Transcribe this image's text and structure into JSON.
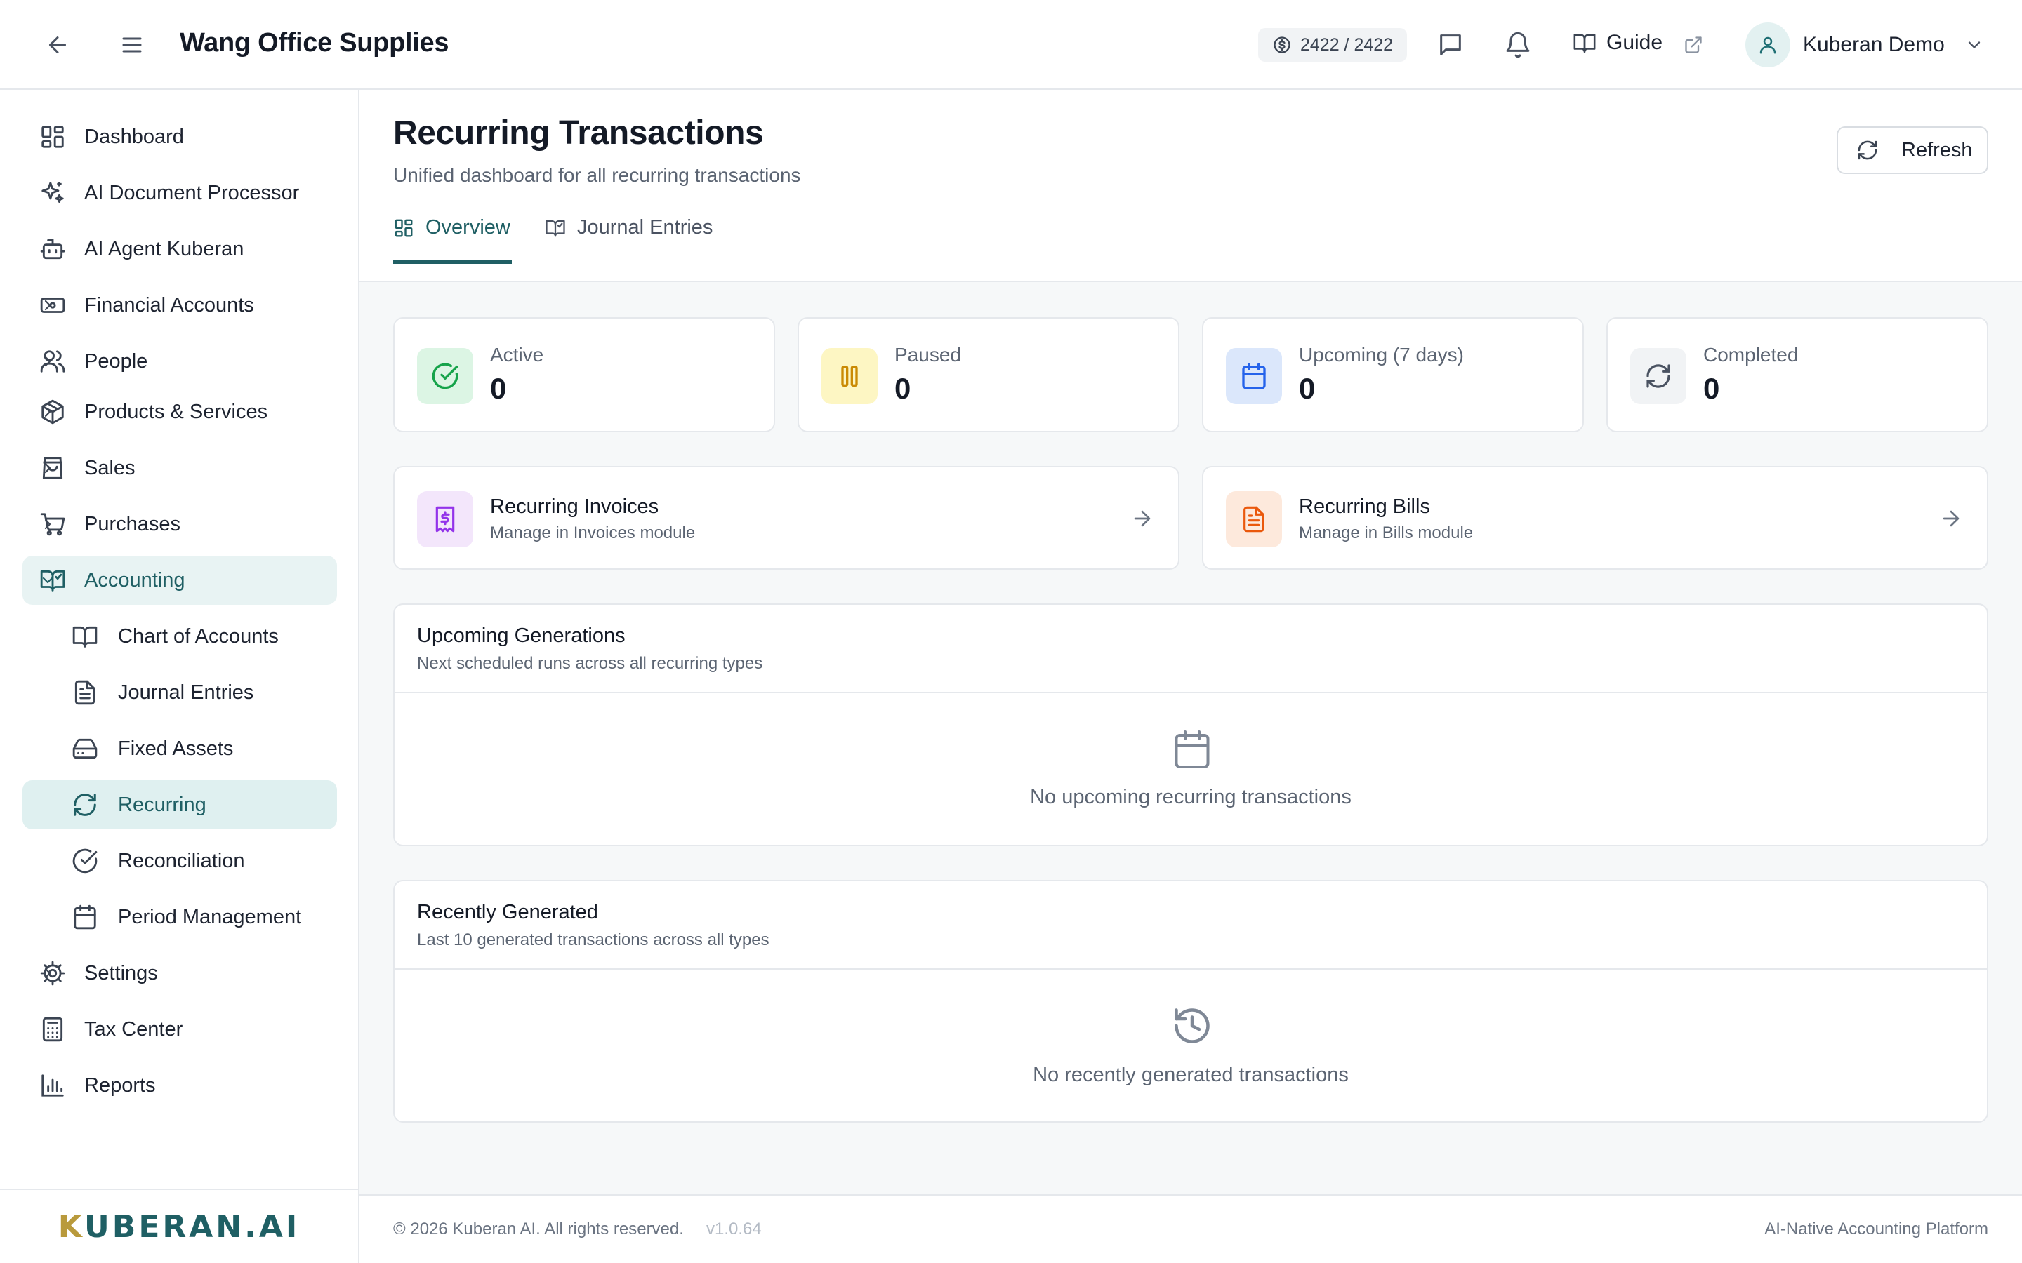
{
  "header": {
    "company": "Wang Office Supplies",
    "credits": "2422 / 2422",
    "guide_label": "Guide",
    "user_name": "Kuberan Demo"
  },
  "sidebar": {
    "items": [
      {
        "label": "Dashboard",
        "icon": "dashboard-icon"
      },
      {
        "label": "AI Document Processor",
        "icon": "sparkles-icon"
      },
      {
        "label": "AI Agent Kuberan",
        "icon": "bot-icon"
      },
      {
        "label": "Financial Accounts",
        "icon": "banknote-icon"
      },
      {
        "label": "People",
        "icon": "users-icon"
      },
      {
        "label": "Products & Services",
        "icon": "package-icon"
      },
      {
        "label": "Sales",
        "icon": "shopping-bag-icon"
      },
      {
        "label": "Purchases",
        "icon": "cart-icon"
      },
      {
        "label": "Accounting",
        "icon": "book-check-icon"
      },
      {
        "label": "Chart of Accounts",
        "icon": "book-open-icon"
      },
      {
        "label": "Journal Entries",
        "icon": "file-text-icon"
      },
      {
        "label": "Fixed Assets",
        "icon": "hard-drive-icon"
      },
      {
        "label": "Recurring",
        "icon": "refresh-icon"
      },
      {
        "label": "Reconciliation",
        "icon": "check-circle-icon"
      },
      {
        "label": "Period Management",
        "icon": "calendar-icon"
      },
      {
        "label": "Settings",
        "icon": "gear-icon"
      },
      {
        "label": "Tax Center",
        "icon": "calculator-icon"
      },
      {
        "label": "Reports",
        "icon": "bar-chart-icon"
      }
    ],
    "active": "Recurring",
    "logo": {
      "k": "K",
      "rest": "UBERAN.AI"
    }
  },
  "page": {
    "title": "Recurring Transactions",
    "subtitle": "Unified dashboard for all recurring transactions",
    "refresh_label": "Refresh",
    "tabs": [
      {
        "label": "Overview",
        "active": true
      },
      {
        "label": "Journal Entries",
        "active": false
      }
    ]
  },
  "stats": [
    {
      "label": "Active",
      "value": "0",
      "color": "#16a34a",
      "bg": "#dcf5e4"
    },
    {
      "label": "Paused",
      "value": "0",
      "color": "#ca8a04",
      "bg": "#fdf6c3"
    },
    {
      "label": "Upcoming (7 days)",
      "value": "0",
      "color": "#2563eb",
      "bg": "#dbe7fb"
    },
    {
      "label": "Completed",
      "value": "0",
      "color": "#4a5261",
      "bg": "#f1f3f5"
    }
  ],
  "links": [
    {
      "title": "Recurring Invoices",
      "subtitle": "Manage in Invoices module",
      "color": "#9333ea",
      "bg": "#f3e6fb"
    },
    {
      "title": "Recurring Bills",
      "subtitle": "Manage in Bills module",
      "color": "#ea580c",
      "bg": "#fde9dc"
    }
  ],
  "upcoming": {
    "title": "Upcoming Generations",
    "subtitle": "Next scheduled runs across all recurring types",
    "empty": "No upcoming recurring transactions"
  },
  "recent": {
    "title": "Recently Generated",
    "subtitle": "Last 10 generated transactions across all types",
    "empty": "No recently generated transactions"
  },
  "footer": {
    "copyright": "© 2026 Kuberan AI. All rights reserved.",
    "version": "v1.0.64",
    "tagline": "AI-Native Accounting Platform"
  }
}
